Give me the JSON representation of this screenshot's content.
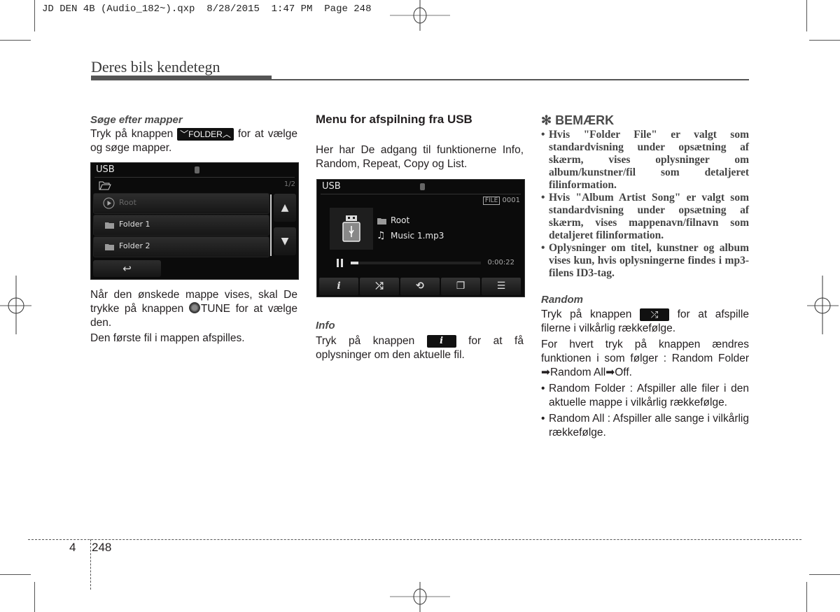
{
  "slug": "JD DEN 4B (Audio_182~).qxp  8/28/2015  1:47 PM  Page 248",
  "section_title": "Deres bils kendetegn",
  "left_col": {
    "subhead": "Søge efter mapper",
    "p1_before": "Tryk på knappen ",
    "folder_btn": "FOLDER",
    "p1_after": " for at vælge og søge mapper.",
    "screen": {
      "title": "USB",
      "page_indicator": "1/2",
      "items": [
        {
          "label": "Root",
          "icon": "play-circle-icon"
        },
        {
          "label": "Folder 1",
          "icon": "folder-icon"
        },
        {
          "label": "Folder 2",
          "icon": "folder-icon"
        }
      ],
      "up_icon": "▲",
      "down_icon": "▼",
      "back_icon": "↩"
    },
    "p2_before": "Når den ønskede mappe vises, skal De trykke på knappen ",
    "tune_label": "TUNE",
    "p2_after": " for at vælge den.",
    "p3": "Den første fil i mappen afspilles."
  },
  "mid_col": {
    "heading": "Menu for afspilning fra USB",
    "intro": "Her har De adgang til funktionerne Info, Random, Repeat, Copy og List.",
    "screen": {
      "title": "USB",
      "file_badge": "FILE",
      "file_number": "0001",
      "folder": "Root",
      "track": "Music 1.mp3",
      "elapsed": "0:00:22",
      "progress_fraction": 0.06,
      "buttons": [
        {
          "name": "info",
          "glyph": "i"
        },
        {
          "name": "random",
          "glyph": "⤮"
        },
        {
          "name": "repeat",
          "glyph": "⟲"
        },
        {
          "name": "copy",
          "glyph": "❐"
        },
        {
          "name": "list",
          "glyph": "☰"
        }
      ]
    },
    "info_subhead": "Info",
    "info_before": "Tryk på knappen ",
    "info_btn_glyph": "i",
    "info_after": " for at få oplysninger om den aktuelle fil."
  },
  "right_col": {
    "note_heading": "✻ BEMÆRK",
    "notes": [
      "Hvis \"Folder File\" er valgt som standardvisning under opsætning af skærm, vises oplysninger om album/kunstner/fil som detaljeret filinformation.",
      "Hvis \"Album Artist Song\" er valgt som standardvisning under opsætning af skærm, vises mappenavn/filnavn som detaljeret filinformation.",
      "Oplysninger om titel, kunstner og album vises kun, hvis oplysningerne findes i mp3-filens ID3-tag."
    ],
    "random_subhead": "Random",
    "random_before": "Tryk på knappen ",
    "random_btn_glyph": "⤮",
    "random_after": " for at afspille filerne i vilkårlig rækkefølge.",
    "random_p2": "For hvert tryk på knappen ændres funktionen i som følger : Random Folder ➡Random All➡Off.",
    "bullets": [
      "Random Folder : Afspiller alle filer i den aktuelle mappe i vilkårlig rækkefølge.",
      "Random All : Afspiller alle sange i vilkårlig rækkefølge."
    ]
  },
  "footer": {
    "chapter": "4",
    "page": "248"
  }
}
